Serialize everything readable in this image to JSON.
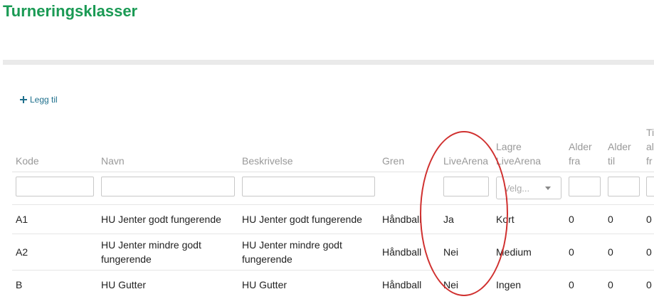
{
  "title": "Turneringsklasser",
  "add_label": "Legg til",
  "headers": {
    "kode": "Kode",
    "navn": "Navn",
    "beskrivelse": "Beskrivelse",
    "gren": "Gren",
    "livearena": "LiveArena",
    "lagre_l1": "Lagre",
    "lagre_l2": "LiveArena",
    "alder_fra_l1": "Alder",
    "alder_fra_l2": "fra",
    "alder_til_l1": "Alder",
    "alder_til_l2": "til",
    "last_l1": "Ti",
    "last_l2": "al",
    "last_l3": "fr"
  },
  "filters": {
    "select_placeholder": "Velg..."
  },
  "rows": [
    {
      "kode": "A1",
      "navn_1": "HU Jenter godt fungerende",
      "navn_2": "",
      "beskrivelse_1": "HU Jenter godt fungerende",
      "beskrivelse_2": "",
      "gren": "Håndball",
      "livearena": "Ja",
      "lagre": "Kort",
      "alder_fra": "0",
      "alder_til": "0",
      "last": "0"
    },
    {
      "kode": "A2",
      "navn_1": "HU Jenter mindre godt",
      "navn_2": "fungerende",
      "beskrivelse_1": "HU Jenter mindre godt",
      "beskrivelse_2": "fungerende",
      "gren": "Håndball",
      "livearena": "Nei",
      "lagre": "Medium",
      "alder_fra": "0",
      "alder_til": "0",
      "last": "0"
    },
    {
      "kode": "B",
      "navn_1": "HU Gutter",
      "navn_2": "",
      "beskrivelse_1": "HU Gutter",
      "beskrivelse_2": "",
      "gren": "Håndball",
      "livearena": "Nei",
      "lagre": "Ingen",
      "alder_fra": "0",
      "alder_til": "0",
      "last": "0"
    }
  ],
  "colors": {
    "title": "#1a9a54",
    "link": "#1e6f8c",
    "annotation": "#d0302f"
  }
}
